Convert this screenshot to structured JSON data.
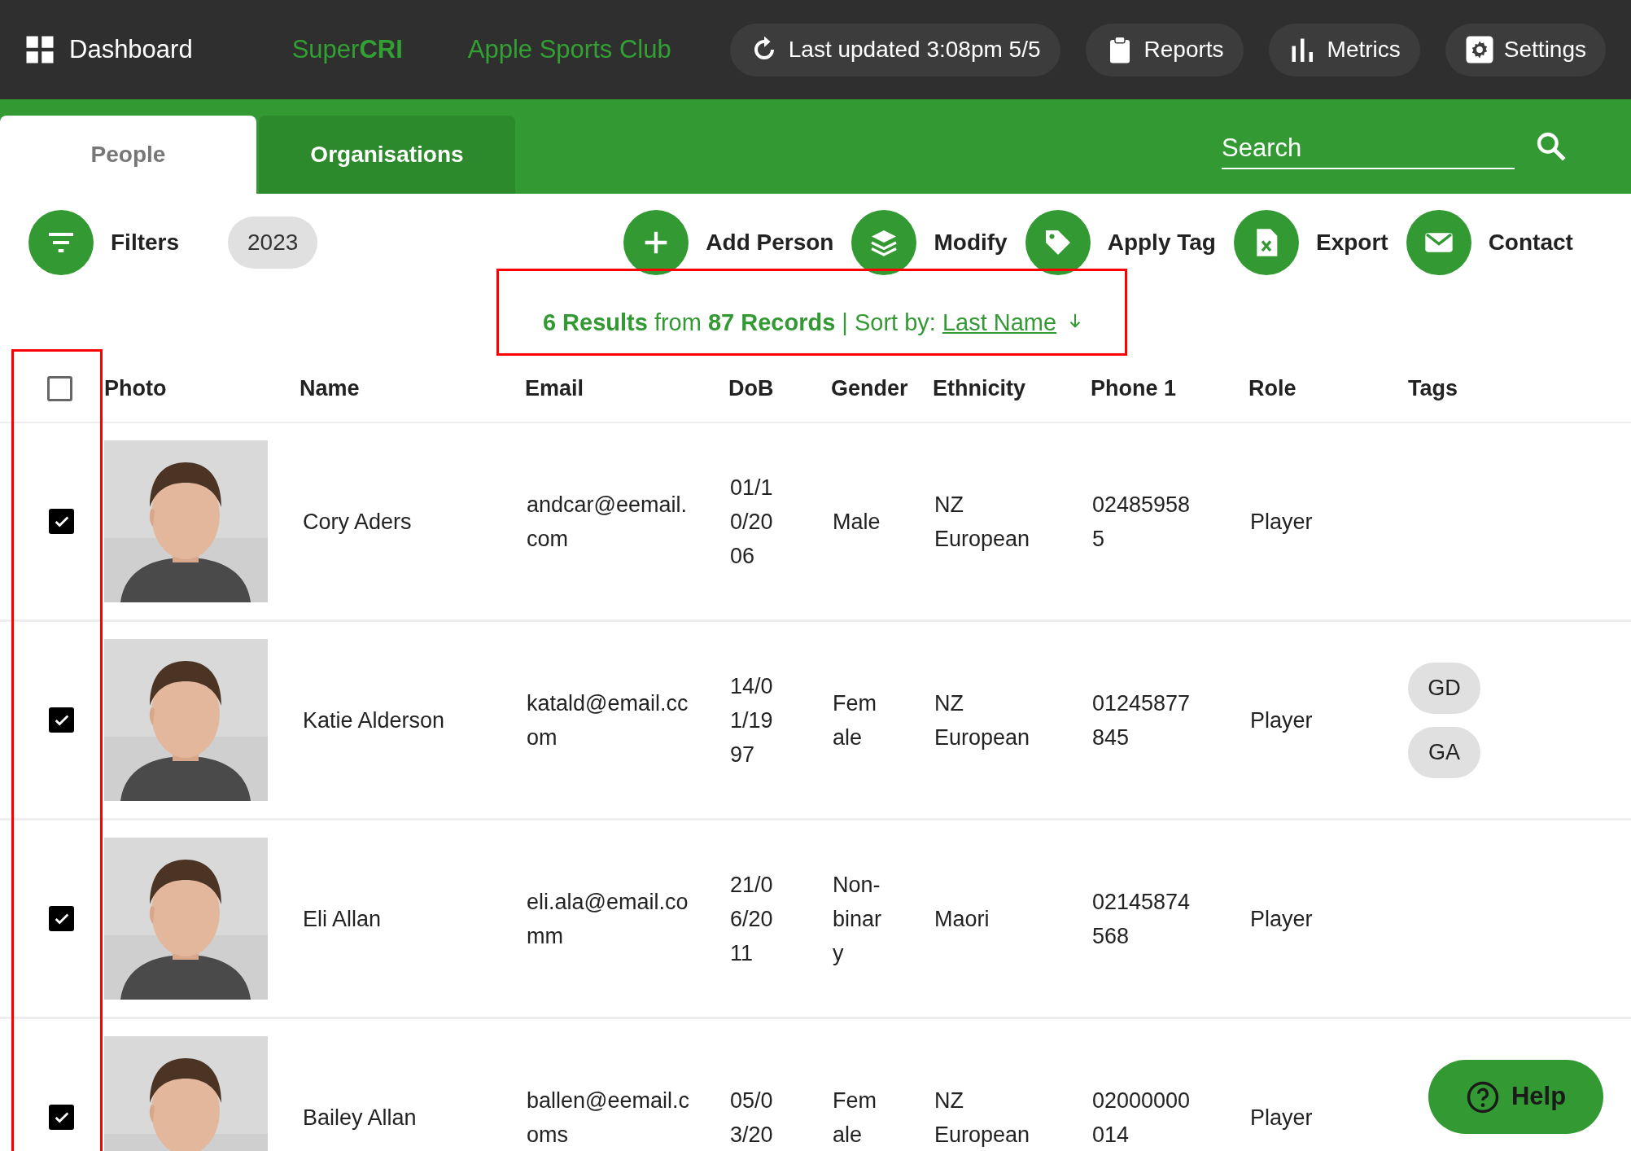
{
  "topbar": {
    "menu_label": "Dashboard",
    "brand": "Super**CRI**",
    "club": "Apple Sports Club",
    "buttons": [
      {
        "kind": "refresh",
        "label": "Last updated 3:08pm 5/5"
      },
      {
        "kind": "clipboard",
        "label": "Reports"
      },
      {
        "kind": "chart",
        "label": "Metrics"
      },
      {
        "kind": "gear",
        "label": "Settings"
      }
    ]
  },
  "tabs": [
    {
      "label": "People",
      "selected": true
    },
    {
      "label": "Organisations",
      "selected": false
    }
  ],
  "search": {
    "placeholder": "Search"
  },
  "filters": {
    "label": "Filters",
    "chips": [
      "2023"
    ]
  },
  "actions": [
    {
      "kind": "add",
      "label": "Add Person"
    },
    {
      "kind": "layers",
      "label": "Modify"
    },
    {
      "kind": "tag",
      "label": "Apply Tag"
    },
    {
      "kind": "excel",
      "label": "Export"
    },
    {
      "kind": "mail",
      "label": "Contact"
    }
  ],
  "summary": {
    "text": "**6 Results** from **87 Records** | Sort by:",
    "sort_field": "Last Name"
  },
  "table": {
    "select_all": {
      "checked": false
    },
    "columns": [
      "Photo",
      "Name",
      "Email",
      "DoB",
      "Gender",
      "Ethnicity",
      "Phone 1",
      "Role",
      "Tags"
    ],
    "rows": [
      {
        "checked": true,
        "photo": {
          "kind": "picture"
        },
        "name": "Cory Aders",
        "email": "andcar@eemail.com",
        "dob": "01/10/2006",
        "gender": "Male",
        "ethnicity": "NZ European",
        "phone": "024859585",
        "role": "Player",
        "tags": []
      },
      {
        "checked": true,
        "photo": {
          "kind": "picture"
        },
        "name": "Katie Alderson",
        "email": "katald@email.ccom",
        "dob": "14/01/1997",
        "gender": "Female",
        "ethnicity": "NZ European",
        "phone": "01245877845",
        "role": "Player",
        "tags": [
          "GD",
          "GA"
        ]
      },
      {
        "checked": true,
        "photo": {
          "kind": "picture"
        },
        "name": "Eli Allan",
        "email": "eli.ala@email.comm",
        "dob": "21/06/2011",
        "gender": "Non-binary",
        "ethnicity": "Maori",
        "phone": "02145874568",
        "role": "Player",
        "tags": []
      },
      {
        "checked": true,
        "photo": {
          "kind": "picture"
        },
        "name": "Bailey Allan",
        "email": "ballen@eemail.coms",
        "dob": "05/03/20",
        "gender": "Female",
        "ethnicity": "NZ European",
        "phone": "02000000014",
        "role": "Player",
        "tags": []
      }
    ]
  },
  "help": {
    "label": "Help"
  }
}
